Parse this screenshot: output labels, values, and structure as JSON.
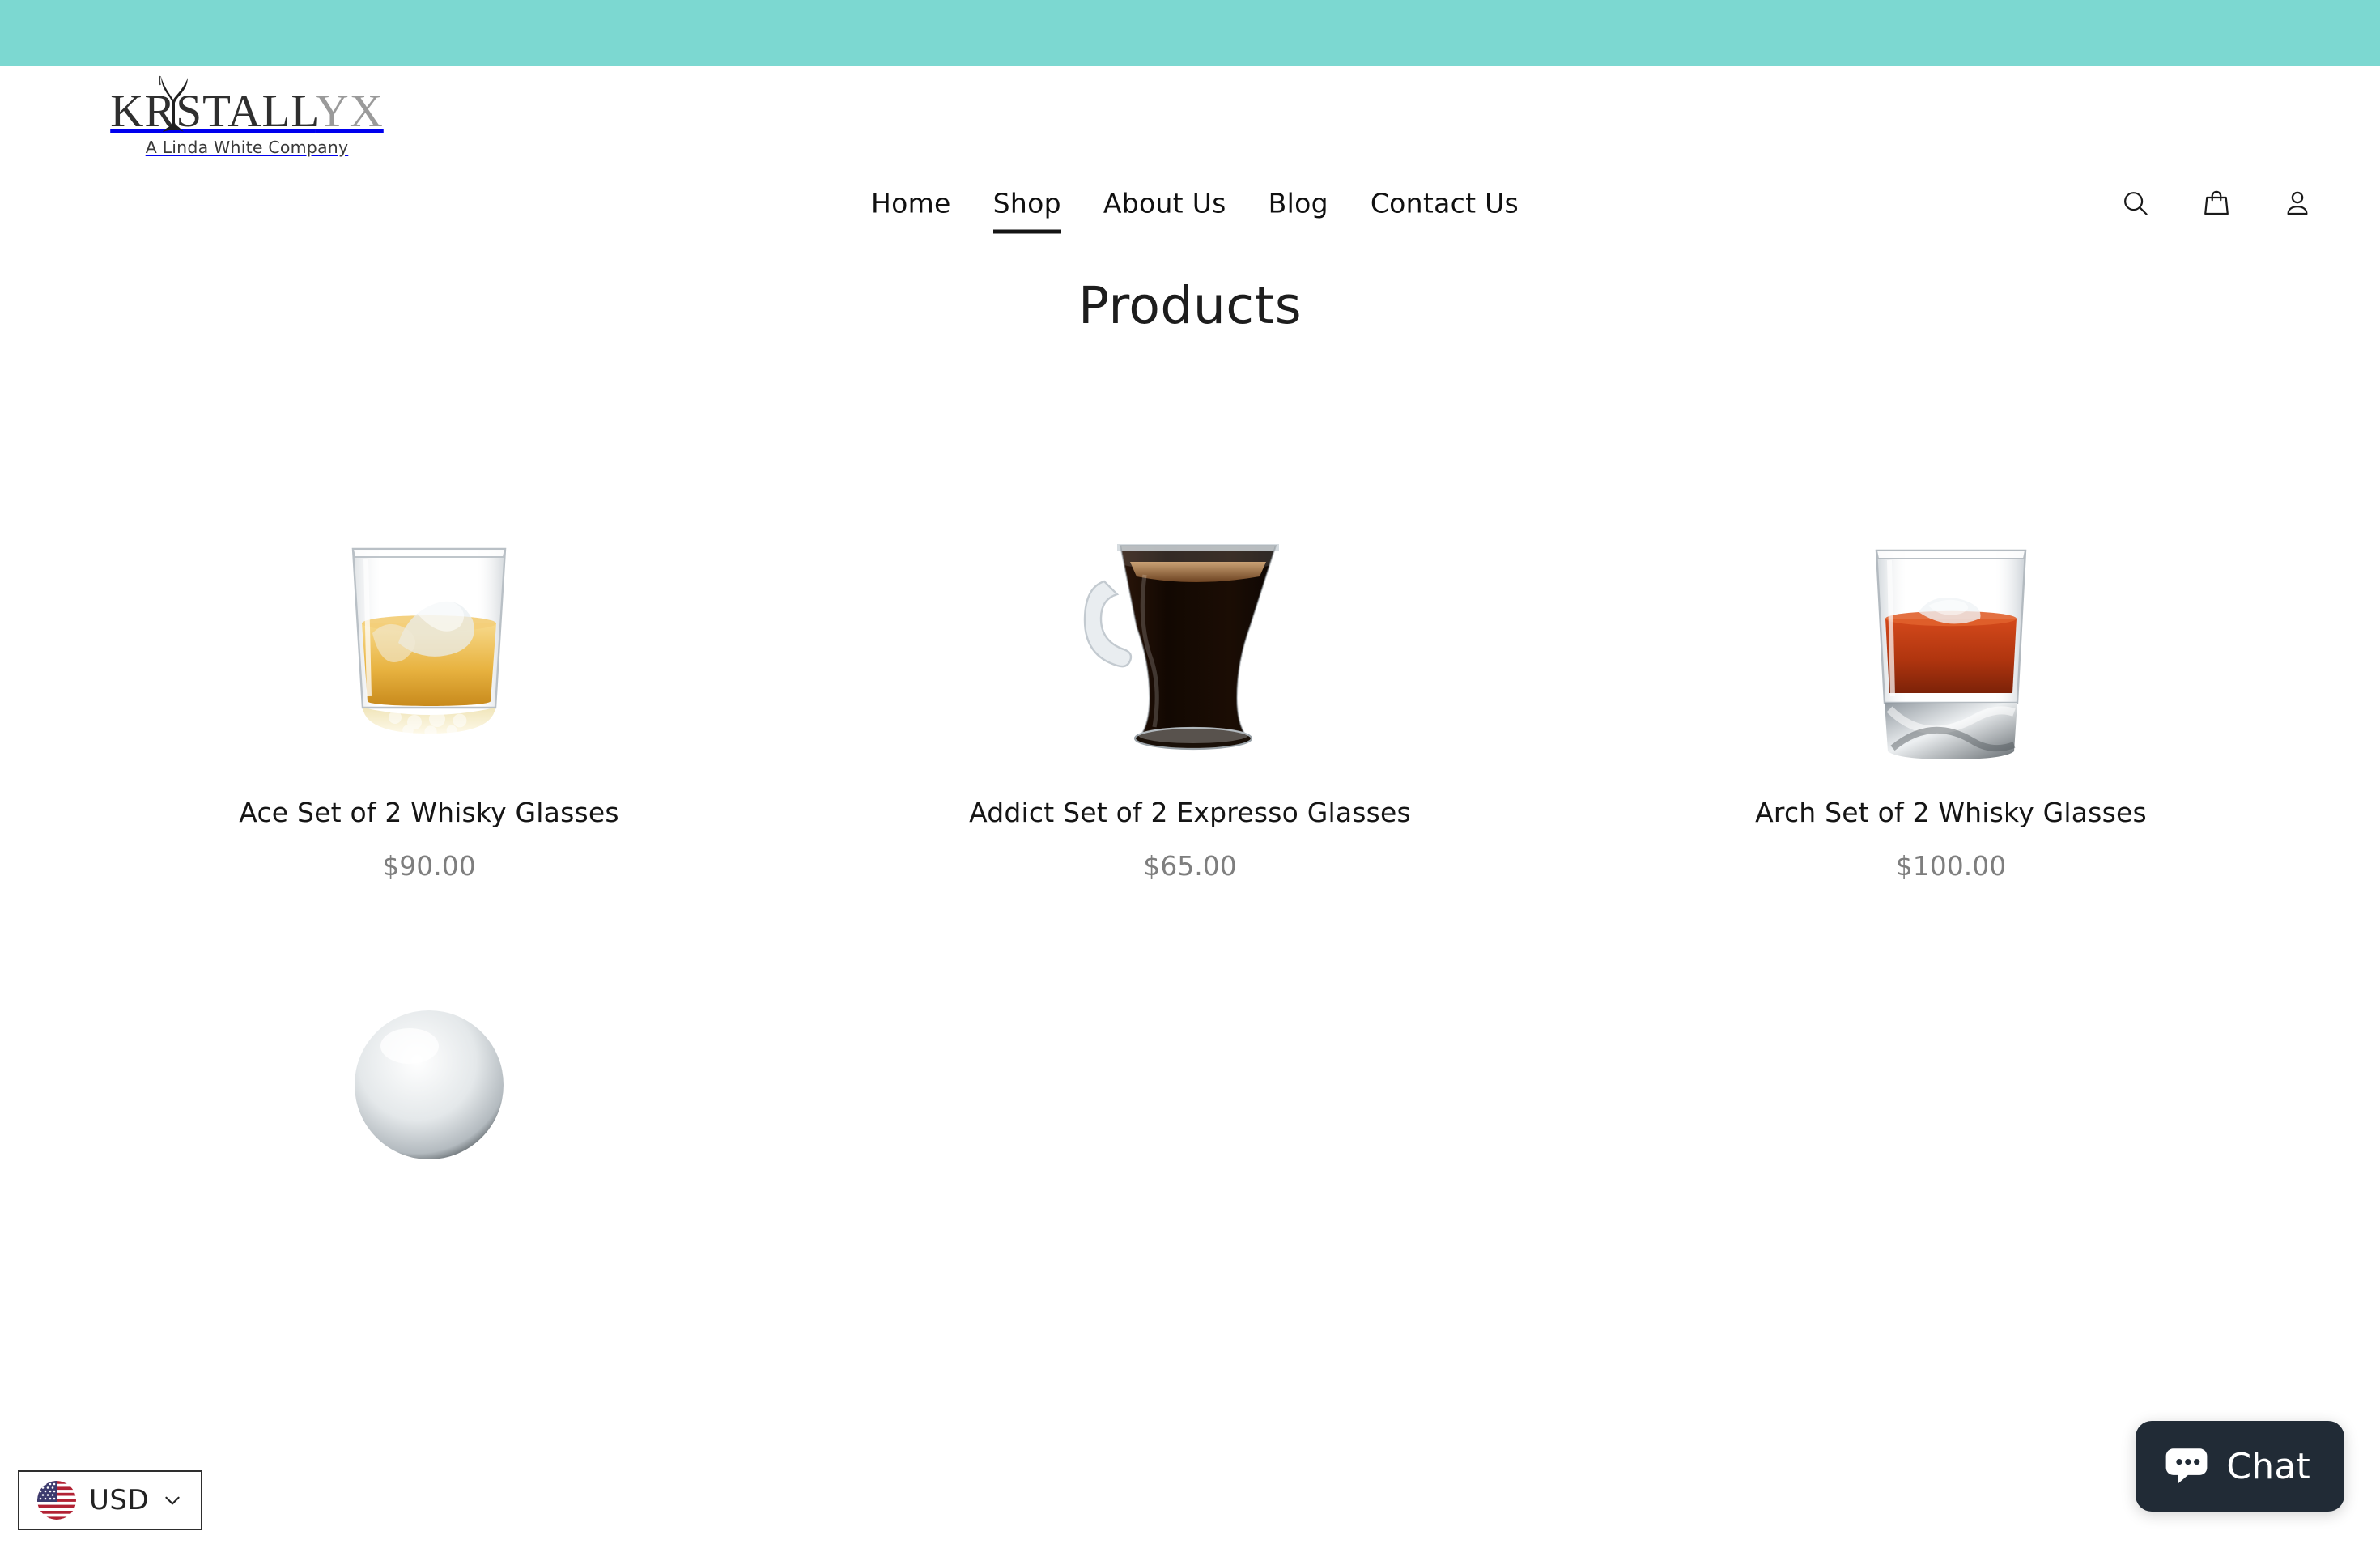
{
  "announcement_bar": {
    "color": "#7cd8d1"
  },
  "header": {
    "brand": {
      "wordmark_dark": "KR",
      "wordmark_mid": "STALL",
      "wordmark_light": "YX",
      "full_name": "KRYSTALLYX",
      "tagline": "A Linda White Company"
    },
    "nav": [
      {
        "label": "Home",
        "active": false
      },
      {
        "label": "Shop",
        "active": true
      },
      {
        "label": "About Us",
        "active": false
      },
      {
        "label": "Blog",
        "active": false
      },
      {
        "label": "Contact Us",
        "active": false
      }
    ],
    "actions": [
      {
        "icon": "search-icon",
        "label": "Search"
      },
      {
        "icon": "shopping-bag-icon",
        "label": "Cart"
      },
      {
        "icon": "account-icon",
        "label": "Account"
      }
    ]
  },
  "main": {
    "title": "Products",
    "products": [
      {
        "title": "Ace Set of 2 Whisky Glasses",
        "price": "$90.00",
        "image": "whisky-tumbler-amber"
      },
      {
        "title": "Addict Set of 2 Expresso Glasses",
        "price": "$65.00",
        "image": "espresso-glass-coffee"
      },
      {
        "title": "Arch Set of 2 Whisky Glasses",
        "price": "$100.00",
        "image": "whisky-tumbler-red"
      }
    ],
    "products_row_2": [
      {
        "title": "",
        "price": "",
        "image": "glass-sphere-partial"
      }
    ]
  },
  "currency_selector": {
    "code": "USD",
    "flag": "us-flag-icon",
    "chevron": "chevron-down-icon"
  },
  "chat_widget": {
    "label": "Chat",
    "icon": "chat-bubble-icon",
    "background": "#212b36"
  }
}
